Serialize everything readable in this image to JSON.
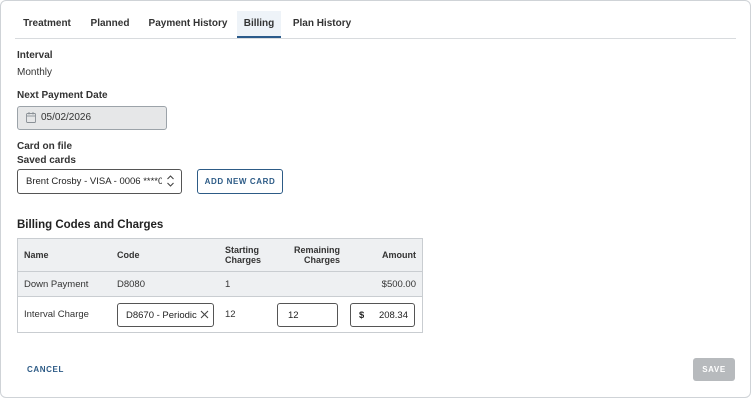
{
  "tabs": [
    {
      "label": "Treatment",
      "active": false
    },
    {
      "label": "Planned",
      "active": false
    },
    {
      "label": "Payment History",
      "active": false
    },
    {
      "label": "Billing",
      "active": true
    },
    {
      "label": "Plan History",
      "active": false
    }
  ],
  "interval": {
    "label": "Interval",
    "value": "Monthly"
  },
  "next_payment": {
    "label": "Next Payment Date",
    "value": "05/02/2026"
  },
  "card": {
    "label": "Card on file",
    "sub_label": "Saved cards",
    "selected": "Brent Crosby - VISA - 0006 ****0",
    "add_button": "ADD NEW CARD"
  },
  "billing": {
    "title": "Billing Codes and Charges",
    "headers": {
      "name": "Name",
      "code": "Code",
      "starting": "Starting Charges",
      "remaining": "Remaining Charges",
      "amount": "Amount"
    },
    "rows": [
      {
        "name": "Down Payment",
        "code": "D8080",
        "starting": "1",
        "remaining": "",
        "amount": "$500.00"
      },
      {
        "name": "Interval Charge",
        "code": "D8670 - Periodic",
        "starting": "12",
        "remaining": "12",
        "currency": "$",
        "amount": "208.34"
      }
    ]
  },
  "footer": {
    "cancel": "CANCEL",
    "save": "SAVE"
  },
  "colors": {
    "accent": "#2d5b86",
    "disabled": "#b7babd",
    "row_shade": "#eef0f2"
  },
  "icons": {
    "calendar": "calendar-icon",
    "select_arrows": "chevron-up-down-icon",
    "clear": "close-icon"
  }
}
